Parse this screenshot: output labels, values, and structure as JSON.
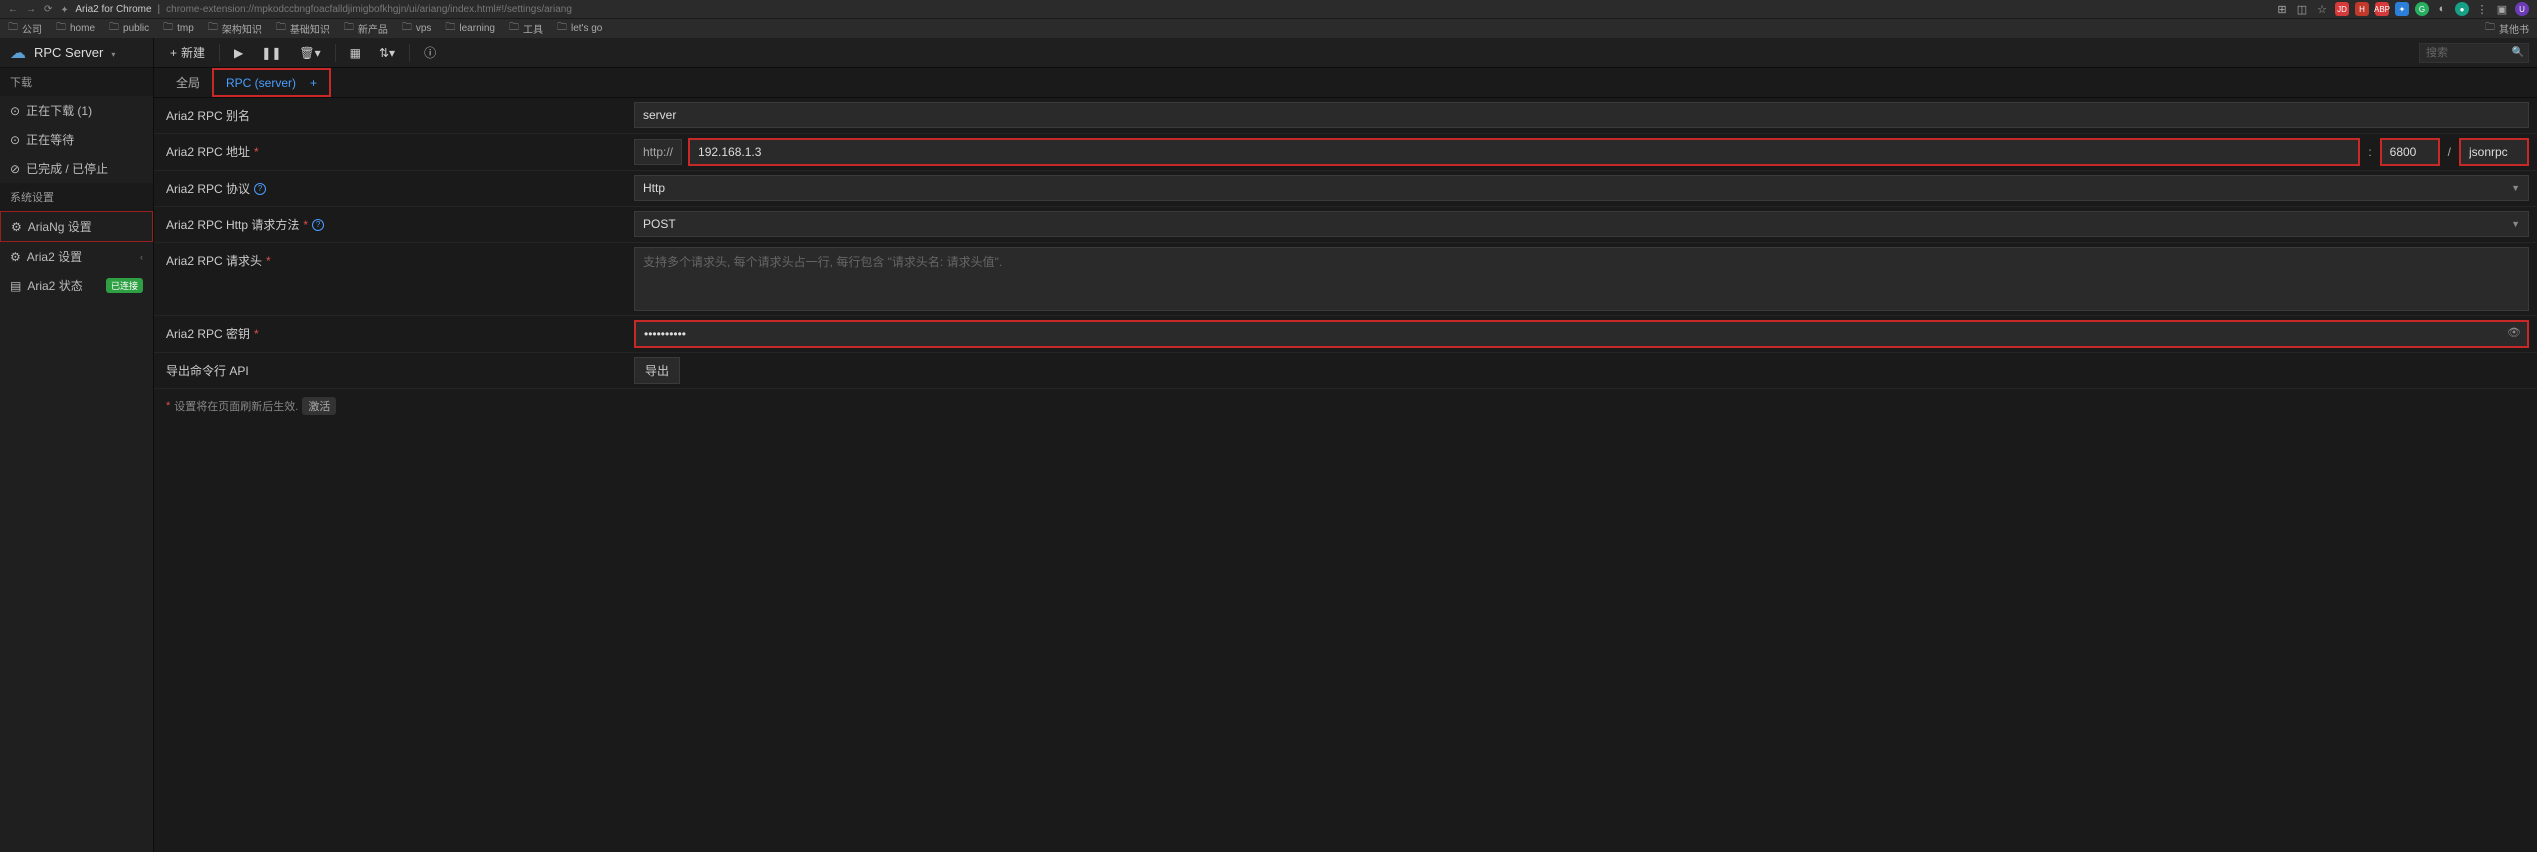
{
  "browser": {
    "title": "Aria2 for Chrome",
    "url": "chrome-extension://mpkodccbngfoacfalldjimigbofkhgjn/ui/ariang/index.html#!/settings/ariang",
    "other_bookmarks": "其他书"
  },
  "bookmarks": [
    "公司",
    "home",
    "public",
    "tmp",
    "架构知识",
    "基础知识",
    "新产品",
    "vps",
    "learning",
    "工具",
    "let's go"
  ],
  "sidebar": {
    "title": "RPC Server",
    "sections": {
      "download": "下载",
      "system": "系统设置"
    },
    "items": {
      "downloading": "正在下载 (1)",
      "waiting": "正在等待",
      "stopped": "已完成 / 已停止",
      "ariang_settings": "AriaNg 设置",
      "aria2_settings": "Aria2 设置",
      "aria2_status": "Aria2 状态",
      "status_badge": "已连接"
    }
  },
  "toolbar": {
    "new": "新建",
    "search_placeholder": "搜索"
  },
  "tabs": {
    "global": "全局",
    "rpc": "RPC (server)"
  },
  "form": {
    "alias_label": "Aria2 RPC 别名",
    "alias_value": "server",
    "address_label": "Aria2 RPC 地址",
    "protocol_prefix": "http://",
    "host_value": "192.168.1.3",
    "port_value": "6800",
    "path_value": "jsonrpc",
    "protocol_label": "Aria2 RPC 协议",
    "protocol_value": "Http",
    "method_label": "Aria2 RPC Http 请求方法",
    "method_value": "POST",
    "headers_label": "Aria2 RPC 请求头",
    "headers_placeholder": "支持多个请求头, 每个请求头占一行, 每行包含 \"请求头名: 请求头值\".",
    "secret_label": "Aria2 RPC 密钥",
    "secret_value": "••••••••••",
    "export_label": "导出命令行 API",
    "export_button": "导出",
    "note_text": "设置将在页面刷新后生效.",
    "note_pill": "激活"
  }
}
